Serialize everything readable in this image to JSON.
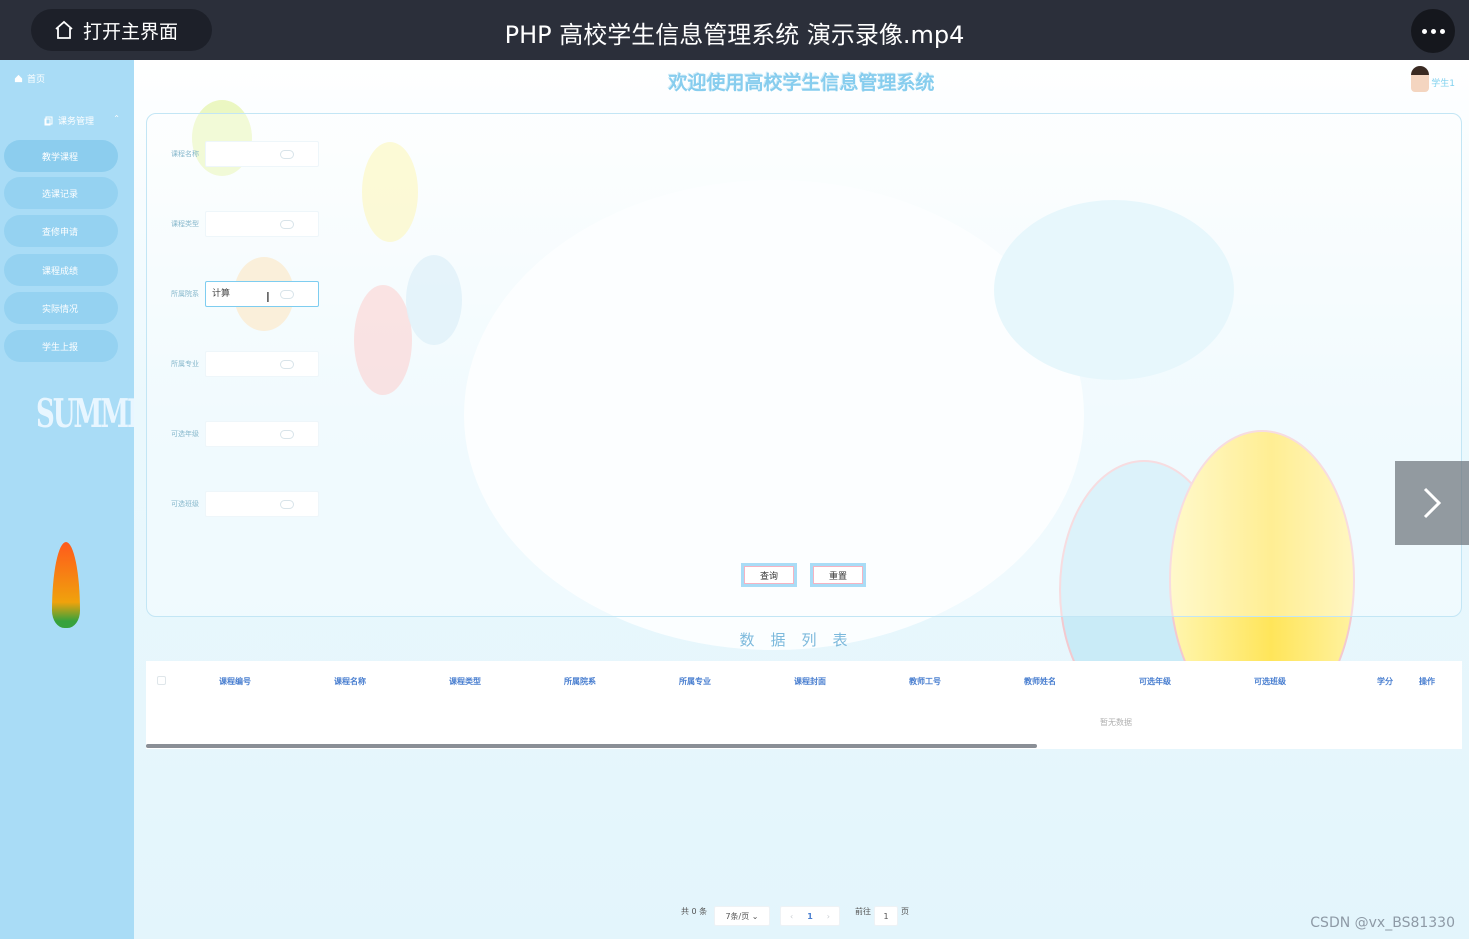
{
  "player": {
    "home_label": "打开主界面",
    "video_title": "PHP 高校学生信息管理系统 演示录像.mp4"
  },
  "sidebar": {
    "home": "首页",
    "group": "课务管理",
    "items": [
      {
        "label": "教学课程"
      },
      {
        "label": "选课记录"
      },
      {
        "label": "查修申请"
      },
      {
        "label": "课程成绩"
      },
      {
        "label": "实际情况"
      },
      {
        "label": "学生上报"
      }
    ],
    "summer_text": "SUMMER"
  },
  "header": {
    "title": "欢迎使用高校学生信息管理系统",
    "user": "学生1"
  },
  "search": {
    "fields": [
      {
        "label": "课程名称",
        "value": ""
      },
      {
        "label": "课程类型",
        "value": ""
      },
      {
        "label": "所属院系",
        "value": "计算"
      },
      {
        "label": "所属专业",
        "value": ""
      },
      {
        "label": "可选年级",
        "value": ""
      },
      {
        "label": "可选班级",
        "value": ""
      }
    ],
    "query_button": "查询",
    "reset_button": "重置"
  },
  "list": {
    "title": "数据列表",
    "columns": [
      "课程编号",
      "课程名称",
      "课程类型",
      "所属院系",
      "所属专业",
      "课程封面",
      "教师工号",
      "教师姓名",
      "可选年级",
      "可选班级",
      "学分",
      "操作"
    ],
    "empty_text": "暂无数据"
  },
  "pagination": {
    "total": "共 0 条",
    "page_size": "7条/页",
    "current_page": "1",
    "goto_label": "前往",
    "goto_value": "1",
    "page_suffix": "页"
  },
  "watermark": "CSDN @vx_BS81330"
}
